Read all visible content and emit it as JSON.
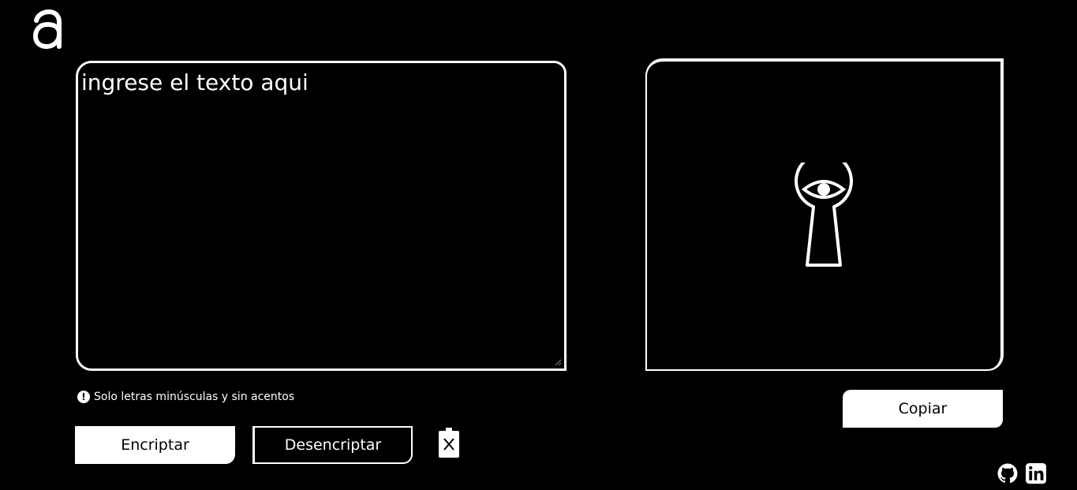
{
  "header": {
    "logo_icon": "letter-a-logo-icon"
  },
  "input": {
    "placeholder": "ingrese el texto aqui",
    "value": ""
  },
  "output": {
    "illustration": "keyhole-eye-icon"
  },
  "hint": {
    "icon": "exclamation-circle-icon",
    "text": "Solo letras minúsculas y sin acentos"
  },
  "buttons": {
    "encrypt_label": "Encriptar",
    "decrypt_label": "Desencriptar",
    "copy_label": "Copiar",
    "clear_icon": "trash-clear-icon"
  },
  "footer": {
    "github_icon": "github-icon",
    "linkedin_icon": "linkedin-icon"
  },
  "colors": {
    "background": "#000000",
    "foreground": "#ffffff"
  }
}
